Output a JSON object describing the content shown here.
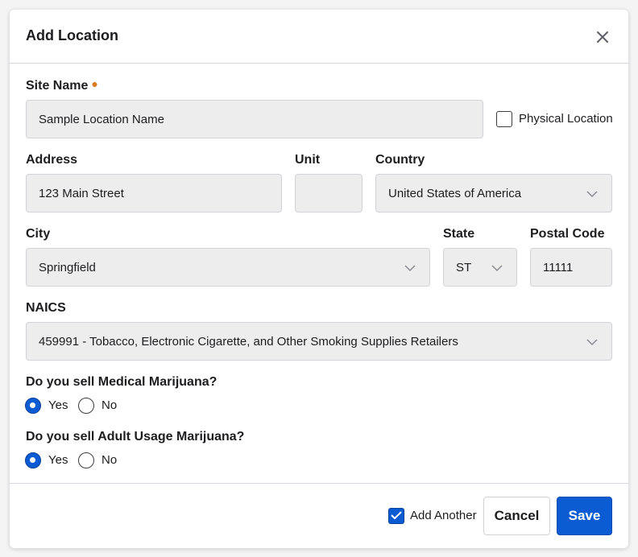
{
  "dialog": {
    "title": "Add Location",
    "close_icon": "close-icon"
  },
  "form": {
    "site_name": {
      "label": "Site Name",
      "required": true,
      "value": "Sample Location Name"
    },
    "physical_location": {
      "label": "Physical Location",
      "checked": false
    },
    "address": {
      "label": "Address",
      "value": "123 Main Street"
    },
    "unit": {
      "label": "Unit",
      "value": ""
    },
    "country": {
      "label": "Country",
      "value": "United States of America"
    },
    "city": {
      "label": "City",
      "value": "Springfield"
    },
    "state": {
      "label": "State",
      "value": "ST"
    },
    "postal_code": {
      "label": "Postal Code",
      "value": "11111"
    },
    "naics": {
      "label": "NAICS",
      "value": "459991 - Tobacco, Electronic Cigarette, and Other Smoking Supplies Retailers"
    },
    "medical_marijuana": {
      "question": "Do you sell Medical Marijuana?",
      "options": [
        {
          "label": "Yes",
          "selected": true
        },
        {
          "label": "No",
          "selected": false
        }
      ]
    },
    "adult_usage_marijuana": {
      "question": "Do you sell Adult Usage Marijuana?",
      "options": [
        {
          "label": "Yes",
          "selected": true
        },
        {
          "label": "No",
          "selected": false
        }
      ]
    }
  },
  "footer": {
    "add_another": {
      "label": "Add Another",
      "checked": true
    },
    "cancel_label": "Cancel",
    "save_label": "Save"
  },
  "colors": {
    "primary": "#0b5bd3",
    "required_dot": "#d97a1e",
    "field_bg": "#ededee"
  }
}
